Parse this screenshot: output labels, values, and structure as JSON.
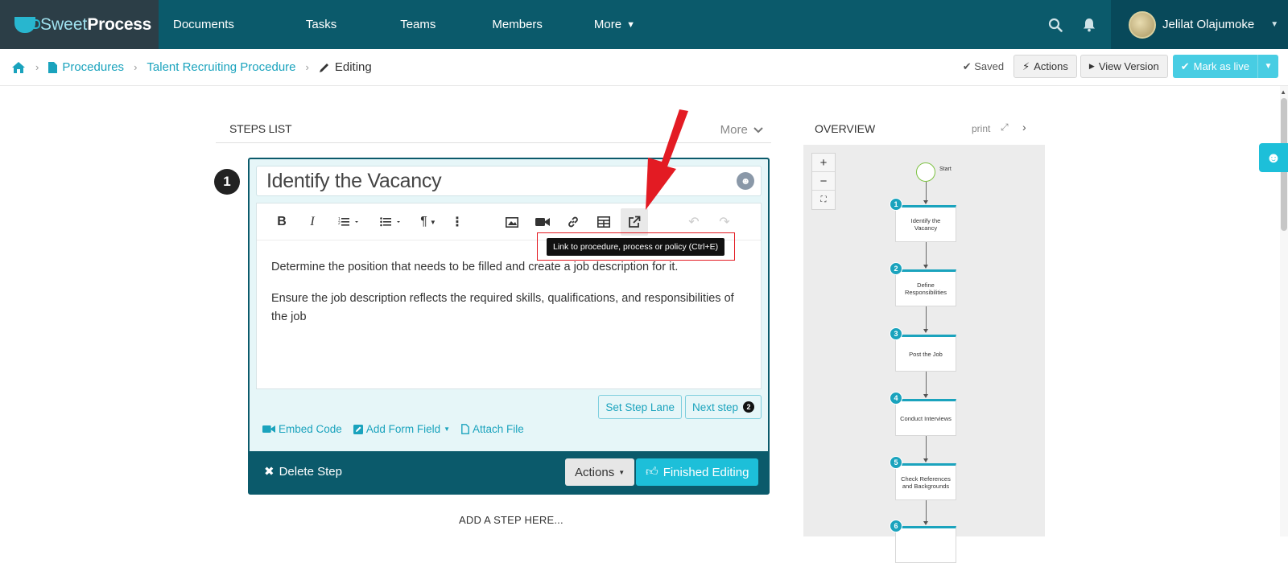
{
  "app": {
    "logo_light": "Sweet",
    "logo_bold": "Process",
    "accent_color": "#1aa3bd",
    "nav_bg": "#0b5a6b"
  },
  "nav": {
    "items": [
      "Documents",
      "Tasks",
      "Teams",
      "Members",
      "More"
    ]
  },
  "user": {
    "name": "Jelilat Olajumoke"
  },
  "breadcrumb": {
    "items": [
      "Procedures",
      "Talent Recruiting Procedure"
    ],
    "current": "Editing"
  },
  "header_actions": {
    "saved": "Saved",
    "actions": "Actions",
    "view_version": "View Version",
    "mark_live": "Mark as live"
  },
  "steps_list": {
    "title": "STEPS LIST",
    "more": "More"
  },
  "step": {
    "number": "1",
    "title": "Identify the Vacancy",
    "paragraphs": [
      "Determine the position that needs to be filled and create a job description for it.",
      "Ensure the job description reflects the required skills, qualifications, and responsibilities of the job"
    ],
    "set_step_lane": "Set Step Lane",
    "next_step": "Next step",
    "next_step_badge": "2",
    "embed_code": "Embed Code",
    "add_form_field": "Add Form Field",
    "attach_file": "Attach File",
    "delete_step": "Delete Step",
    "actions": "Actions",
    "finished_editing": "Finished Editing"
  },
  "tooltip": {
    "text": "Link to procedure, process or policy (Ctrl+E)"
  },
  "add_step": "ADD A STEP HERE...",
  "overview": {
    "title": "OVERVIEW",
    "print": "print",
    "start_label": "Start",
    "steps": [
      {
        "num": "1",
        "label": "Identify the Vacancy"
      },
      {
        "num": "2",
        "label": "Define Responsibilities"
      },
      {
        "num": "3",
        "label": "Post the Job"
      },
      {
        "num": "4",
        "label": "Conduct Interviews"
      },
      {
        "num": "5",
        "label": "Check References and Backgrounds"
      },
      {
        "num": "6",
        "label": ""
      }
    ]
  }
}
